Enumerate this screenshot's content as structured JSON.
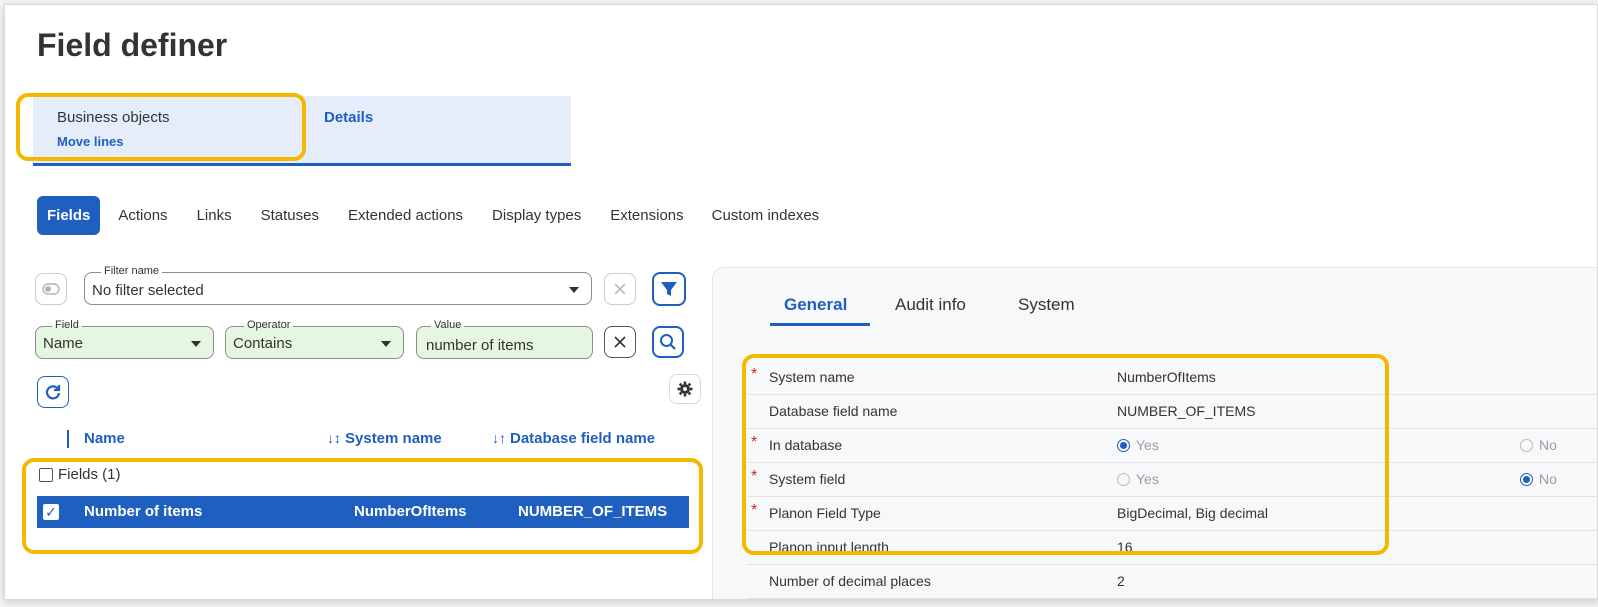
{
  "page": {
    "title": "Field definer"
  },
  "ribbon": {
    "tab1_label": "Business objects",
    "tab1_sub": "Move lines",
    "tab2_label": "Details"
  },
  "subtabs": [
    "Fields",
    "Actions",
    "Links",
    "Statuses",
    "Extended actions",
    "Display types",
    "Extensions",
    "Custom indexes"
  ],
  "filter": {
    "label": "Filter name",
    "value": "No filter selected"
  },
  "search": {
    "field_label": "Field",
    "field_value": "Name",
    "operator_label": "Operator",
    "operator_value": "Contains",
    "value_label": "Value",
    "value_value": "number of items"
  },
  "grid": {
    "columns": [
      "Name",
      "System name",
      "Database field name"
    ],
    "group": "Fields (1)",
    "rows": [
      {
        "name": "Number of items",
        "system_name": "NumberOfItems",
        "db_name": "NUMBER_OF_ITEMS",
        "selected": true
      }
    ]
  },
  "detail_tabs": [
    "General",
    "Audit info",
    "System"
  ],
  "properties": [
    {
      "key": "System name",
      "required": true,
      "value": "NumberOfItems"
    },
    {
      "key": "Database field name",
      "required": false,
      "value": "NUMBER_OF_ITEMS"
    },
    {
      "key": "In database",
      "required": true,
      "yes": "Yes",
      "no": "No",
      "selected": "Yes"
    },
    {
      "key": "System field",
      "required": true,
      "yes": "Yes",
      "no": "No",
      "selected": "No"
    },
    {
      "key": "Planon Field Type",
      "required": true,
      "value": "BigDecimal, Big decimal"
    },
    {
      "key": "Planon input length",
      "required": false,
      "value": "16"
    },
    {
      "key": "Number of decimal places",
      "required": false,
      "value": "2"
    }
  ],
  "colors": {
    "accent": "#1f5fbf",
    "highlight": "#f5b800",
    "field_green": "#e6f7e1",
    "required": "#d12a2a"
  }
}
